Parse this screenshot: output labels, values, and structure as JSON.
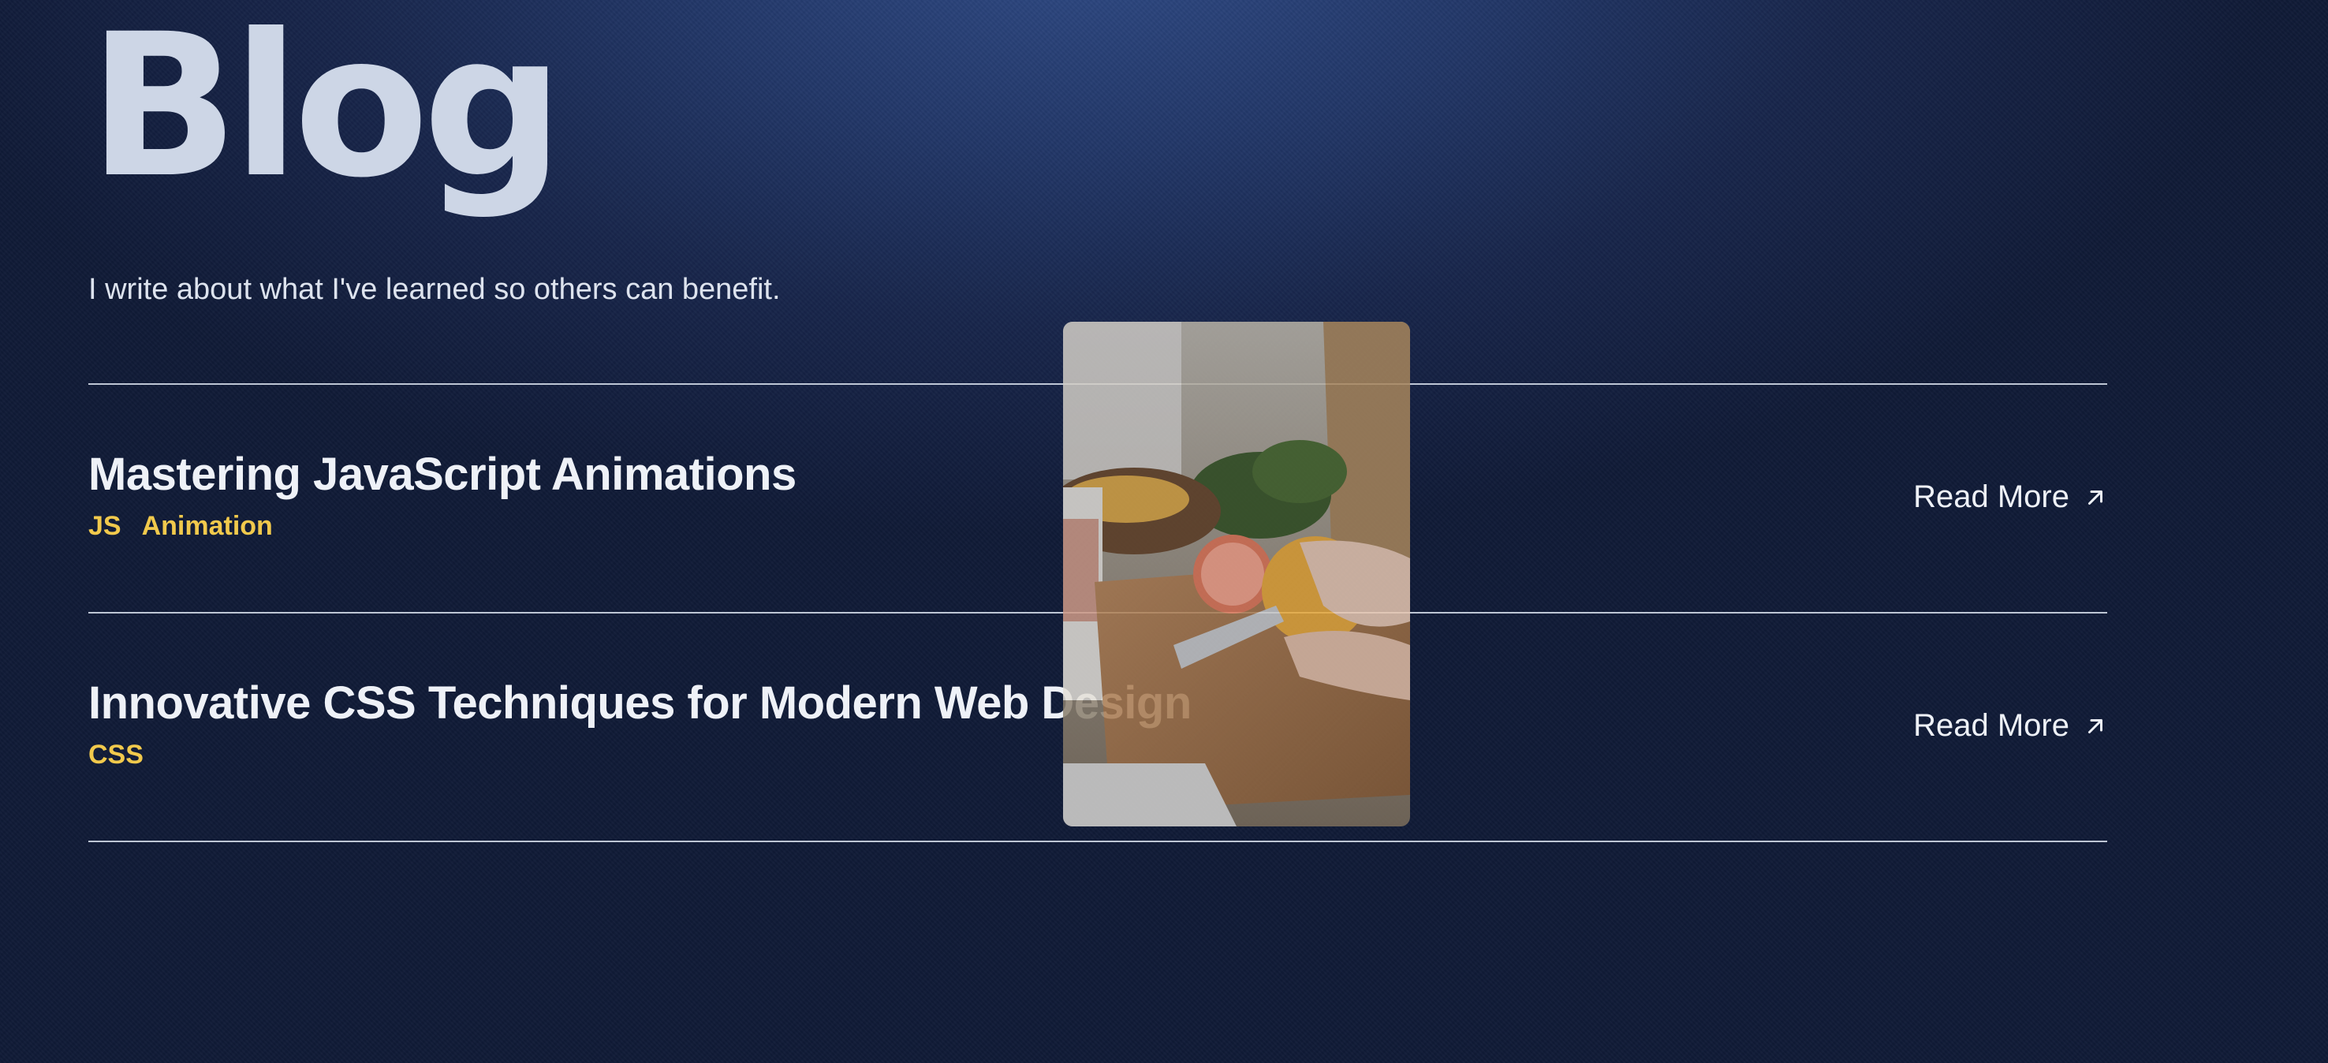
{
  "header": {
    "title": "Blog",
    "subtitle": "I write about what I've learned so others can benefit."
  },
  "posts": [
    {
      "title": "Mastering JavaScript Animations",
      "tags": [
        "JS",
        "Animation"
      ],
      "read_more_label": "Read More"
    },
    {
      "title": "Innovative CSS Techniques for Modern Web Design",
      "tags": [
        "CSS"
      ],
      "read_more_label": "Read More"
    }
  ],
  "colors": {
    "tag": "#f1c94c",
    "background": "#17254a",
    "text": "#eef1f7"
  },
  "icons": {
    "read_more": "arrow-up-right-icon"
  }
}
